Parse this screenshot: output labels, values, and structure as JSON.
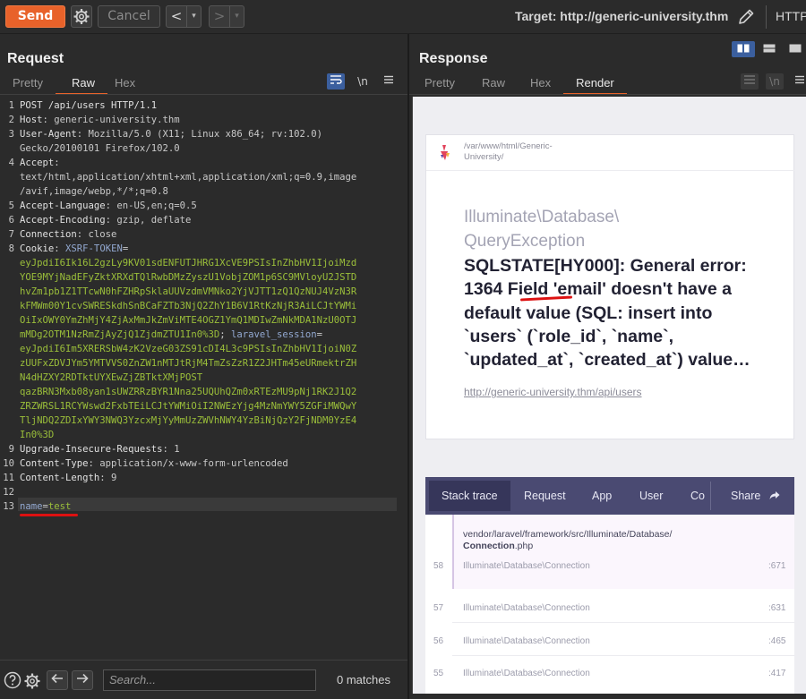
{
  "toolbar": {
    "send_label": "Send",
    "cancel_label": "Cancel",
    "back_label": "<",
    "forward_label": ">",
    "dropdown_label": "▾",
    "target_text": "Target: http://generic-university.thm",
    "http_label": "HTTP"
  },
  "request": {
    "title": "Request",
    "tabs": [
      "Pretty",
      "Raw",
      "Hex"
    ],
    "active_tab": "Raw",
    "newline_label": "\\n",
    "lines": [
      {
        "n": "1",
        "parts": [
          {
            "t": "POST /api/users HTTP/1.1",
            "c": "hname"
          }
        ]
      },
      {
        "n": "2",
        "parts": [
          {
            "t": "Host",
            "c": "hname"
          },
          {
            "t": ": generic-university.thm",
            "c": "hval"
          }
        ]
      },
      {
        "n": "3",
        "parts": [
          {
            "t": "User-Agent",
            "c": "hname"
          },
          {
            "t": ": Mozilla/5.0 (X11; Linux x86_64; rv:102.0)",
            "c": "hval"
          }
        ]
      },
      {
        "n": "",
        "parts": [
          {
            "t": "Gecko/20100101 Firefox/102.0",
            "c": "hval"
          }
        ]
      },
      {
        "n": "4",
        "parts": [
          {
            "t": "Accept",
            "c": "hname"
          },
          {
            "t": ":",
            "c": "hval"
          }
        ]
      },
      {
        "n": "",
        "parts": [
          {
            "t": "text/html,application/xhtml+xml,application/xml;q=0.9,image",
            "c": "hval"
          }
        ]
      },
      {
        "n": "",
        "parts": [
          {
            "t": "/avif,image/webp,*/*;q=0.8",
            "c": "hval"
          }
        ]
      },
      {
        "n": "5",
        "parts": [
          {
            "t": "Accept-Language",
            "c": "hname"
          },
          {
            "t": ": en-US,en;q=0.5",
            "c": "hval"
          }
        ]
      },
      {
        "n": "6",
        "parts": [
          {
            "t": "Accept-Encoding",
            "c": "hname"
          },
          {
            "t": ": gzip, deflate",
            "c": "hval"
          }
        ]
      },
      {
        "n": "7",
        "parts": [
          {
            "t": "Connection",
            "c": "hname"
          },
          {
            "t": ": close",
            "c": "hval"
          }
        ]
      },
      {
        "n": "8",
        "parts": [
          {
            "t": "Cookie",
            "c": "hname"
          },
          {
            "t": ": ",
            "c": "hval"
          },
          {
            "t": "XSRF-TOKEN",
            "c": "cname"
          },
          {
            "t": "=",
            "c": "hval"
          }
        ]
      },
      {
        "n": "",
        "parts": [
          {
            "t": "eyJpdiI6Ik16L2gzLy9KV01sdENFUTJHRG1XcVE9PSIsInZhbHV1IjoiMzd",
            "c": "cookie"
          }
        ]
      },
      {
        "n": "",
        "parts": [
          {
            "t": "YOE9MYjNadEFyZktXRXdTQlRwbDMzZyszU1VobjZOM1p6SC9MVloyU2JSTD",
            "c": "cookie"
          }
        ]
      },
      {
        "n": "",
        "parts": [
          {
            "t": "hvZm1pb1Z1TTcwN0hFZHRpSklaUUVzdmVMNko2YjVJTT1zQ1QzNUJ4VzN3R",
            "c": "cookie"
          }
        ]
      },
      {
        "n": "",
        "parts": [
          {
            "t": "kFMWm00Y1cvSWRESkdhSnBCaFZTb3NjQ2ZhY1B6V1RtKzNjR3AiLCJtYWMi",
            "c": "cookie"
          }
        ]
      },
      {
        "n": "",
        "parts": [
          {
            "t": "OiIxOWY0YmZhMjY4ZjAxMmJkZmViMTE4OGZ1YmQ1MDIwZmNkMDA1NzU0OTJ",
            "c": "cookie"
          }
        ]
      },
      {
        "n": "",
        "parts": [
          {
            "t": "mMDg2OTM1NzRmZjAyZjQ1ZjdmZTU1In0%3D",
            "c": "cookie"
          },
          {
            "t": "; ",
            "c": "hval"
          },
          {
            "t": "laravel_session",
            "c": "cname"
          },
          {
            "t": "=",
            "c": "hval"
          }
        ]
      },
      {
        "n": "",
        "parts": [
          {
            "t": "eyJpdiI6Im5XRERSbW4zK2VzeG03ZS91cDI4L3c9PSIsInZhbHV1IjoiN0Z",
            "c": "cookie"
          }
        ]
      },
      {
        "n": "",
        "parts": [
          {
            "t": "zUUFxZDVJYm5YMTVVS0ZnZW1nMTJtRjM4TmZsZzR1Z2JHTm45eURmektrZH",
            "c": "cookie"
          }
        ]
      },
      {
        "n": "",
        "parts": [
          {
            "t": "N4dHZXY2RDTktUYXEwZjZBTktXMjPOST",
            "c": "cookie"
          }
        ]
      },
      {
        "n": "",
        "parts": [
          {
            "t": "qazBRN3Mxb08yan1sUWZRRzBYR1Nna25UQUhQZm0xRTEzMU9pNj1RK2J1Q2",
            "c": "cookie"
          }
        ]
      },
      {
        "n": "",
        "parts": [
          {
            "t": "ZRZWRSL1RCYWswd2FxbTEiLCJtYWMiOiI2NWEzYjg4MzNmYWY5ZGFiMWQwY",
            "c": "cookie"
          }
        ]
      },
      {
        "n": "",
        "parts": [
          {
            "t": "TljNDQ2ZDIxYWY3NWQ3YzcxMjYyMmUzZWVhNWY4YzBiNjQzY2FjNDM0YzE4",
            "c": "cookie"
          }
        ]
      },
      {
        "n": "",
        "parts": [
          {
            "t": "In0%3D",
            "c": "cookie"
          }
        ]
      },
      {
        "n": "9",
        "parts": [
          {
            "t": "Upgrade-Insecure-Requests",
            "c": "hname"
          },
          {
            "t": ": 1",
            "c": "hval"
          }
        ]
      },
      {
        "n": "10",
        "parts": [
          {
            "t": "Content-Type",
            "c": "hname"
          },
          {
            "t": ": application/x-www-form-urlencoded",
            "c": "hval"
          }
        ]
      },
      {
        "n": "11",
        "parts": [
          {
            "t": "Content-Length",
            "c": "hname"
          },
          {
            "t": ": 9",
            "c": "hval"
          }
        ]
      },
      {
        "n": "12",
        "parts": []
      },
      {
        "n": "13",
        "parts": [
          {
            "t": "name",
            "c": "cname"
          },
          {
            "t": "=",
            "c": "hval"
          },
          {
            "t": "test",
            "c": "cookie"
          }
        ]
      }
    ]
  },
  "search": {
    "placeholder": "Search...",
    "matches": "0 matches"
  },
  "response": {
    "title": "Response",
    "tabs": [
      "Pretty",
      "Raw",
      "Hex",
      "Render"
    ],
    "active_tab": "Render",
    "newline_label": "\\n",
    "render": {
      "path_line1": "/var/www/html/Generic-",
      "path_line2": "University/",
      "exception_class_line1": "Illuminate\\Database\\",
      "exception_class_line2": "QueryException",
      "message_lines": [
        "SQLSTATE[HY000]: General error:",
        "1364 Field 'email' doesn't have a",
        "default value (SQL: insert into",
        "`users` (`role_id`, `name`,",
        "`updated_at`, `created_at`) value…"
      ],
      "url": "http://generic-university.thm/api/users",
      "stack_tabs": [
        "Stack trace",
        "Request",
        "App",
        "User",
        "Co"
      ],
      "share_label": "Share",
      "active_frame_file_line1": "vendor/laravel/framework/src/Illuminate/Database/",
      "active_frame_file_line2": "Connection",
      "active_frame_file_ext": ".php",
      "frames": [
        {
          "num": "58",
          "cls": "Illuminate\\Database\\Connection",
          "line": ":671"
        },
        {
          "num": "57",
          "cls": "Illuminate\\Database\\Connection",
          "line": ":631"
        },
        {
          "num": "56",
          "cls": "Illuminate\\Database\\Connection",
          "line": ":465"
        },
        {
          "num": "55",
          "cls": "Illuminate\\Database\\Connection",
          "line": ":417"
        }
      ]
    }
  },
  "colors": {
    "accent": "#e8622a",
    "ignition_nav": "#4a4a72",
    "cookie_value": "#9bbf3a",
    "cookie_name": "#92a8d0",
    "annotation_red": "#dd1111"
  }
}
